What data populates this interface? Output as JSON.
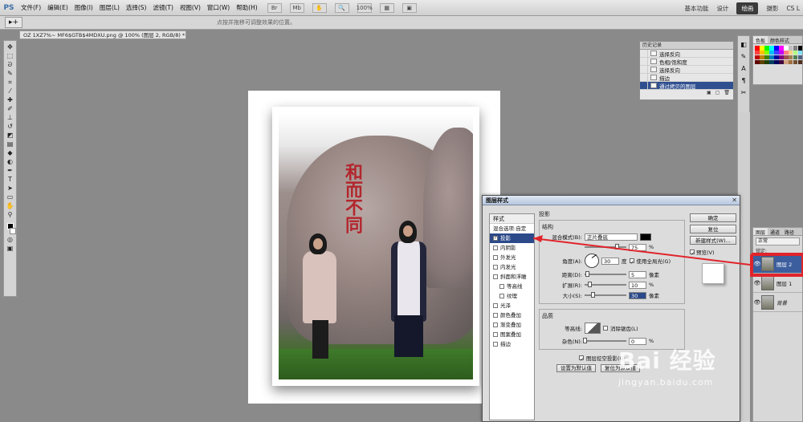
{
  "menubar": {
    "logo": "PS",
    "items": [
      "文件(F)",
      "编辑(E)",
      "图像(I)",
      "图层(L)",
      "选择(S)",
      "滤镜(T)",
      "视图(V)",
      "窗口(W)",
      "帮助(H)"
    ],
    "zoom": "100%",
    "workspaces": [
      "基本功能",
      "设计",
      "绘画",
      "摄影"
    ],
    "active_workspace": "绘画",
    "cslive": "CS L"
  },
  "options": {
    "tool_icon": "▸+",
    "hint": "点按并拖移可调整效果的位置。"
  },
  "document": {
    "tab": "OZ 1XZ7%~ MF6$GTB$4MDXU.png @ 100% (图层 2, RGB/8) *"
  },
  "canvas": {
    "calligraphy": "和而不同"
  },
  "history": {
    "title": "历史记录",
    "items": [
      "选择反向",
      "色相/饱和度",
      "选择反向",
      "描边",
      "通过拷贝的图层"
    ]
  },
  "swatches": {
    "tabs": [
      "色板",
      "颜色样式"
    ]
  },
  "layers": {
    "tabs": [
      "图层",
      "通道",
      "路径"
    ],
    "blend": "正常",
    "lock": "锁定:",
    "items": [
      {
        "name": "图层 2",
        "selected": true
      },
      {
        "name": "图层 1",
        "selected": false
      },
      {
        "name": "背景",
        "selected": false
      }
    ]
  },
  "dialog": {
    "title": "图层样式",
    "styles_header": "样式",
    "blend_options": "混合选项:自定",
    "style_items": [
      {
        "label": "投影",
        "checked": true,
        "selected": true,
        "indent": false
      },
      {
        "label": "内阴影",
        "checked": false,
        "selected": false,
        "indent": false
      },
      {
        "label": "外发光",
        "checked": false,
        "selected": false,
        "indent": false
      },
      {
        "label": "内发光",
        "checked": false,
        "selected": false,
        "indent": false
      },
      {
        "label": "斜面和浮雕",
        "checked": false,
        "selected": false,
        "indent": false
      },
      {
        "label": "等高线",
        "checked": false,
        "selected": false,
        "indent": true
      },
      {
        "label": "纹理",
        "checked": false,
        "selected": false,
        "indent": true
      },
      {
        "label": "光泽",
        "checked": false,
        "selected": false,
        "indent": false
      },
      {
        "label": "颜色叠加",
        "checked": false,
        "selected": false,
        "indent": false
      },
      {
        "label": "渐变叠加",
        "checked": false,
        "selected": false,
        "indent": false
      },
      {
        "label": "图案叠加",
        "checked": false,
        "selected": false,
        "indent": false
      },
      {
        "label": "描边",
        "checked": false,
        "selected": false,
        "indent": false
      }
    ],
    "section_title": "投影",
    "structure": "结构",
    "blend_mode_label": "混合模式(B):",
    "blend_mode_value": "正片叠底",
    "opacity_value": "75",
    "opacity_unit": "%",
    "angle_label": "角度(A):",
    "angle_value": "30",
    "angle_unit": "度",
    "global_light": "使用全局光(G)",
    "distance_label": "距离(D):",
    "distance_value": "5",
    "spread_label": "扩展(R):",
    "spread_value": "10",
    "size_label": "大小(S):",
    "size_value": "30",
    "px_unit": "像素",
    "quality": "品质",
    "contour_label": "等高线:",
    "antialias": "消除锯齿(L)",
    "noise_label": "杂色(N):",
    "noise_value": "0",
    "knockout": "图层挖空投影(U)",
    "make_default": "设置为默认值",
    "reset_default": "复位为默认值",
    "ok": "确定",
    "reset": "复位",
    "new_style": "新建样式(W)...",
    "preview": "预览(V)"
  },
  "watermark": {
    "logo": "Bai 经验",
    "url": "jingyan.baidu.com"
  },
  "colors": {
    "selection": "#2c4a8a",
    "highlight": "#e0242b"
  }
}
